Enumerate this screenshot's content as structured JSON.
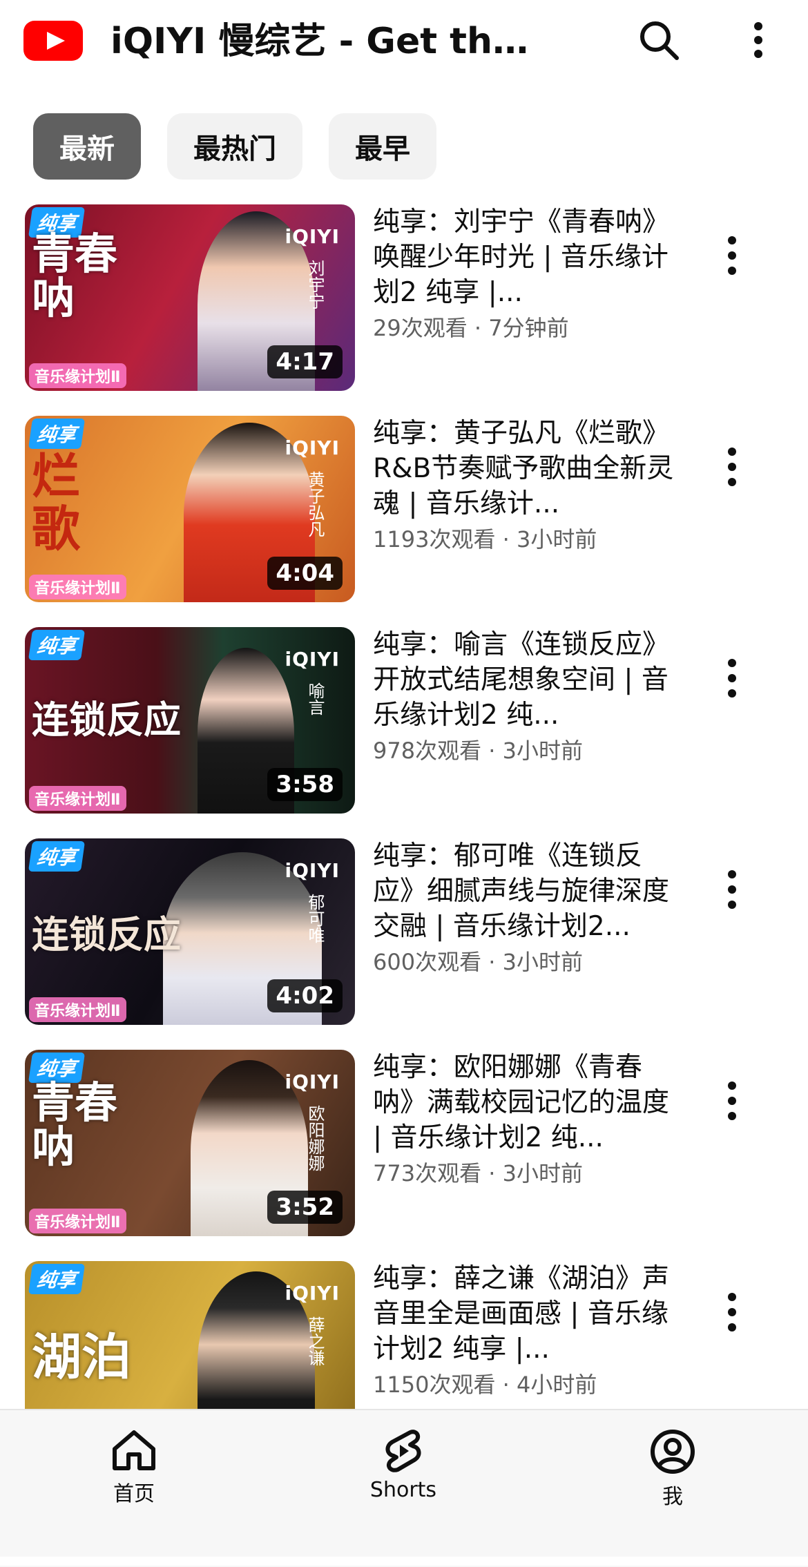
{
  "header": {
    "title": "iQIYI 慢综艺 - Get the...",
    "icons": [
      "youtube-logo",
      "search-icon",
      "more-vert-icon"
    ],
    "brand_color": "#ff0000"
  },
  "chips": [
    {
      "label": "最新",
      "selected": true
    },
    {
      "label": "最热门",
      "selected": false
    },
    {
      "label": "最早",
      "selected": false
    }
  ],
  "videos": [
    {
      "title": "纯享：刘宇宁《青春呐》唤醒少年时光 | 音乐缘计划2 纯享 |...",
      "views": "29次观看",
      "age": "7分钟前",
      "duration": "4:17",
      "thumb": {
        "badge": "纯享",
        "brand": "iQIYI",
        "big_title": "青春呐",
        "name": "刘宇宁",
        "show_logo": "音乐缘计划Ⅱ"
      }
    },
    {
      "title": "纯享：黄子弘凡《烂歌》R&B节奏赋予歌曲全新灵魂 | 音乐缘计...",
      "views": "1193次观看",
      "age": "3小时前",
      "duration": "4:04",
      "thumb": {
        "badge": "纯享",
        "brand": "iQIYI",
        "big_title": "烂歌",
        "name": "黄子弘凡",
        "show_logo": "音乐缘计划Ⅱ"
      }
    },
    {
      "title": "纯享：喻言《连锁反应》开放式结尾想象空间 | 音乐缘计划2 纯...",
      "views": "978次观看",
      "age": "3小时前",
      "duration": "3:58",
      "thumb": {
        "badge": "纯享",
        "brand": "iQIYI",
        "big_title": "连锁反应",
        "name": "喻言",
        "show_logo": "音乐缘计划Ⅱ"
      }
    },
    {
      "title": "纯享：郁可唯《连锁反应》细腻声线与旋律深度交融 | 音乐缘计划2...",
      "views": "600次观看",
      "age": "3小时前",
      "duration": "4:02",
      "thumb": {
        "badge": "纯享",
        "brand": "iQIYI",
        "big_title": "连锁反应",
        "name": "郁可唯",
        "show_logo": "音乐缘计划Ⅱ"
      }
    },
    {
      "title": "纯享：欧阳娜娜《青春呐》满载校园记忆的温度 | 音乐缘计划2 纯...",
      "views": "773次观看",
      "age": "3小时前",
      "duration": "3:52",
      "thumb": {
        "badge": "纯享",
        "brand": "iQIYI",
        "big_title": "青春呐",
        "name": "欧阳娜娜",
        "show_logo": "音乐缘计划Ⅱ"
      }
    },
    {
      "title": "纯享：薛之谦《湖泊》声音里全是画面感 | 音乐缘计划2 纯享 |...",
      "views": "1150次观看",
      "age": "4小时前",
      "duration": "",
      "thumb": {
        "badge": "纯享",
        "brand": "iQIYI",
        "big_title": "湖泊",
        "name": "薛之谦",
        "show_logo": ""
      }
    }
  ],
  "meta_separator": " · ",
  "bottom_nav": [
    {
      "label": "首页",
      "icon": "home-icon"
    },
    {
      "label": "Shorts",
      "icon": "shorts-icon"
    },
    {
      "label": "我",
      "icon": "account-icon"
    }
  ]
}
